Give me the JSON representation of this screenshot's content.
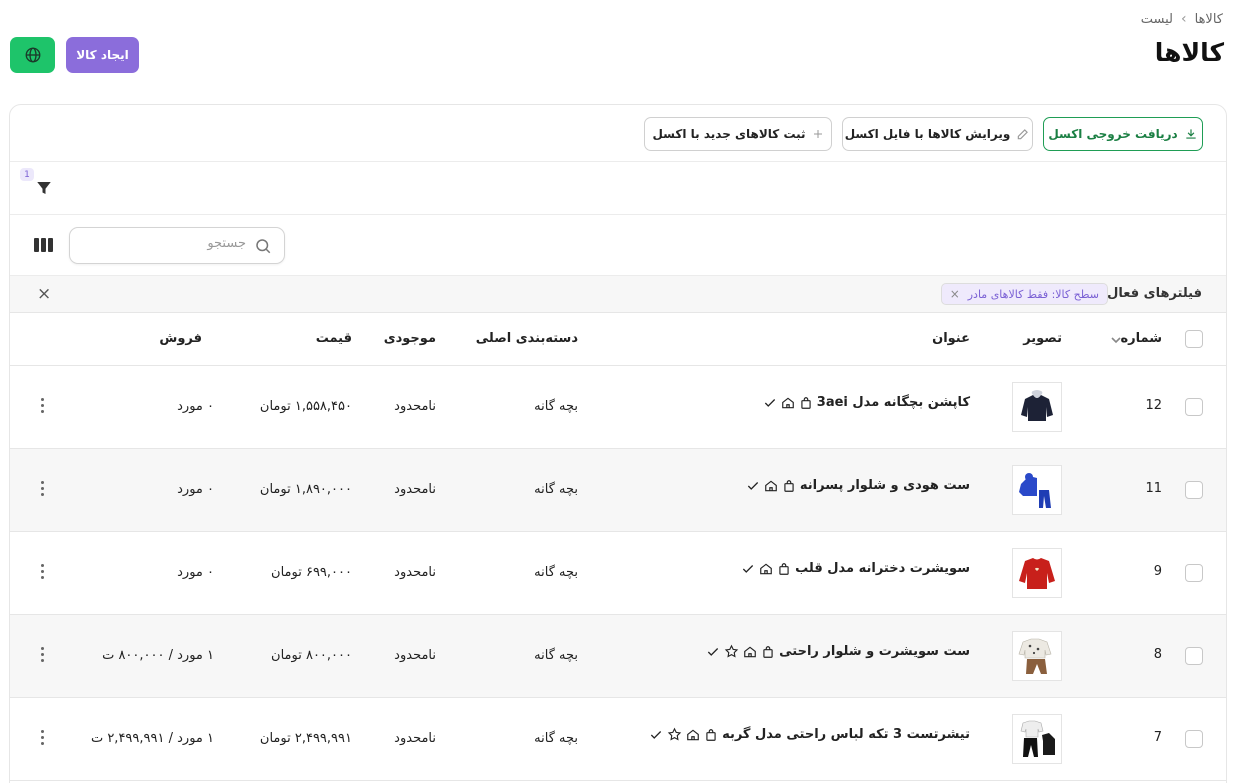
{
  "breadcrumb": {
    "root": "کالاها",
    "current": "لیست",
    "separator": "›"
  },
  "page_title": "کالاها",
  "header_buttons": {
    "create": "ایجاد کالا"
  },
  "toolbar": {
    "export": "دریافت خروجی اکسل",
    "edit_excel": "ویرایش کالاها با فایل اکسل",
    "add_excel": "ثبت کالاهای جدید با اکسل"
  },
  "filter": {
    "count": "1"
  },
  "search": {
    "placeholder": "جستجو"
  },
  "active_filters": {
    "label": "فیلترهای فعال",
    "chips": [
      {
        "text": "سطح کالا: فقط کالاهای مادر",
        "remove": "×"
      }
    ],
    "clear": "×"
  },
  "table": {
    "headers": {
      "number": "شماره",
      "image": "تصویر",
      "title": "عنوان",
      "category": "دسته‌بندی اصلی",
      "stock": "موجودی",
      "price": "قیمت",
      "sales": "فروش"
    },
    "rows": [
      {
        "number": "12",
        "title": "کاپشن بچگانه مدل 3aei",
        "category": "بچه گانه",
        "stock": "نامحدود",
        "price": "۱,۵۵۸,۴۵۰ تومان",
        "sales": "۰ مورد",
        "star": false,
        "image": "jacket"
      },
      {
        "number": "11",
        "title": "ست هودی و شلوار پسرانه",
        "category": "بچه گانه",
        "stock": "نامحدود",
        "price": "۱,۸۹۰,۰۰۰ تومان",
        "sales": "۰ مورد",
        "star": false,
        "image": "hoodie"
      },
      {
        "number": "9",
        "title": "سویشرت دخترانه مدل قلب",
        "category": "بچه گانه",
        "stock": "نامحدود",
        "price": "۶۹۹,۰۰۰ تومان",
        "sales": "۰ مورد",
        "star": false,
        "image": "sweater"
      },
      {
        "number": "8",
        "title": "ست سویشرت و شلوار راحتی",
        "category": "بچه گانه",
        "stock": "نامحدود",
        "price": "۸۰۰,۰۰۰ تومان",
        "sales": "۱ مورد / ۸۰۰,۰۰۰ ت",
        "star": true,
        "image": "set"
      },
      {
        "number": "7",
        "title": "تیشرتست 3 تکه لباس راحتی مدل گربه",
        "category": "بچه گانه",
        "stock": "نامحدود",
        "price": "۲,۴۹۹,۹۹۱ تومان",
        "sales": "۱ مورد / ۲,۴۹۹,۹۹۱ ت",
        "star": true,
        "image": "tshirt"
      }
    ]
  },
  "colors": {
    "accent": "#8b6ddb",
    "green": "#1ec46a",
    "export_green": "#1a7f43"
  }
}
